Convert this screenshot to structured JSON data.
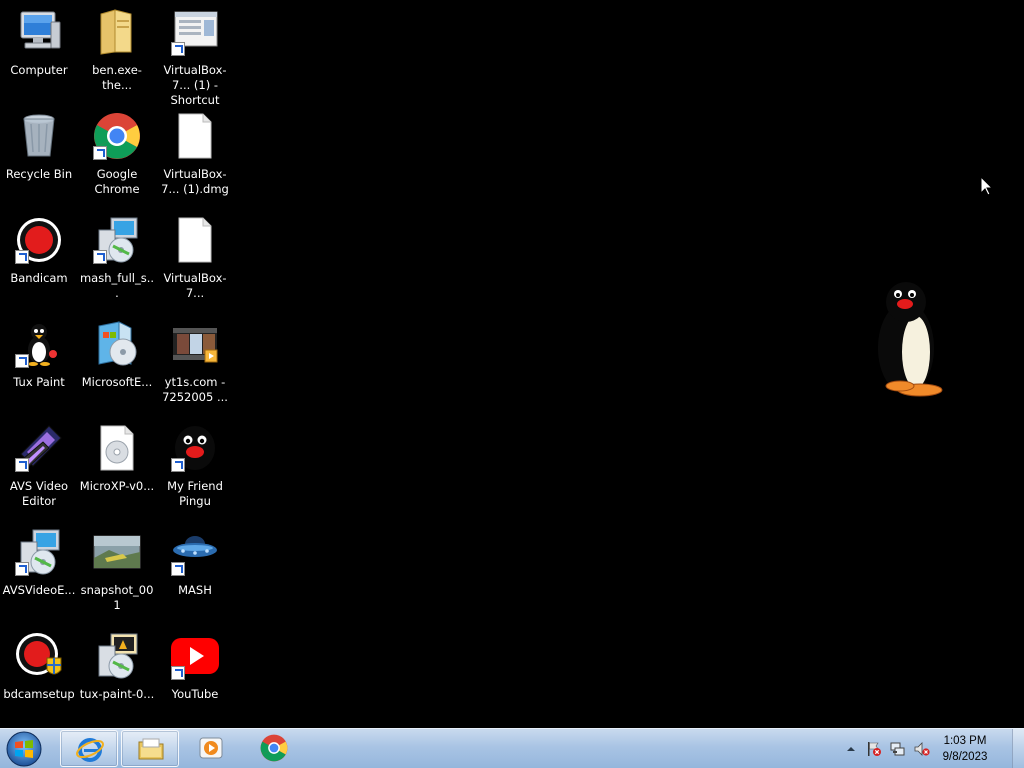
{
  "desktop": {
    "icons": [
      {
        "label": "Computer"
      },
      {
        "label": "ben.exe-the..."
      },
      {
        "label": "VirtualBox-7... (1) - Shortcut"
      },
      {
        "label": "Recycle Bin"
      },
      {
        "label": "Google Chrome"
      },
      {
        "label": "VirtualBox-7... (1).dmg"
      },
      {
        "label": "Bandicam"
      },
      {
        "label": "mash_full_s..."
      },
      {
        "label": "VirtualBox-7..."
      },
      {
        "label": "Tux Paint"
      },
      {
        "label": "MicrosoftE..."
      },
      {
        "label": "yt1s.com - 7252005 ..."
      },
      {
        "label": "AVS Video Editor"
      },
      {
        "label": "MicroXP-v0..."
      },
      {
        "label": "My Friend Pingu"
      },
      {
        "label": "AVSVideoE..."
      },
      {
        "label": "snapshot_001"
      },
      {
        "label": "MASH"
      },
      {
        "label": "bdcamsetup"
      },
      {
        "label": "tux-paint-0..."
      },
      {
        "label": "YouTube"
      }
    ]
  },
  "taskbar": {
    "clock_time": "1:03 PM",
    "clock_date": "9/8/2023"
  }
}
